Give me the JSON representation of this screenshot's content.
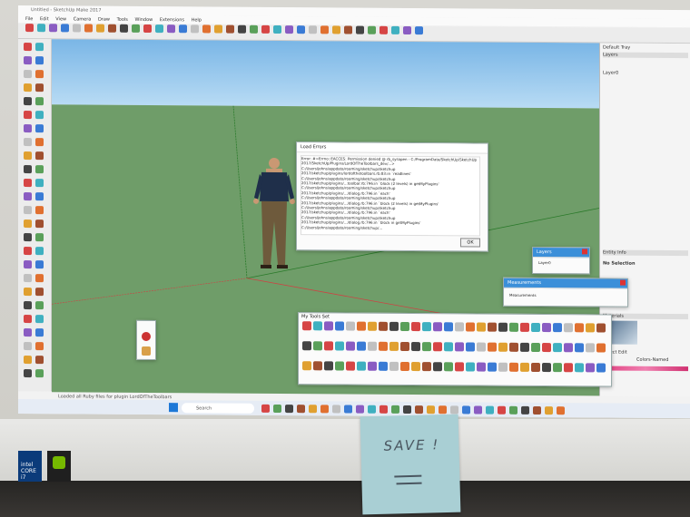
{
  "sketchup": {
    "title": "Untitled - SketchUp Make 2017",
    "menu": [
      "File",
      "Edit",
      "View",
      "Camera",
      "Draw",
      "Tools",
      "Window",
      "Extensions",
      "Help"
    ],
    "status": "Loaded all Ruby files for plugin LordOfTheToolbars",
    "search_placeholder": "Search"
  },
  "load_errors": {
    "title": "Load Errors",
    "text": "Error: #<Errno::EACCES: Permission denied @ rb_sysopen - C:/ProgramData/SketchUp/SketchUp\n2017/SketchUp/Plugins/LordOfTheToolbars_dev/...>\nC:/Users/johns/appdata/roaming/sketchup/sketchup\n2017/sketchup/plugins/lordofthetoolbars.rb:83:in `readlines'\nC:/Users/johns/appdata/roaming/sketchup/sketchup\n2017/sketchup/plugins/...toolbar.rb:796:in `block (2 levels) in getMyPlugins'\nC:/Users/johns/appdata/roaming/sketchup/sketchup\n2017/sketchup/plugins/.../dialog.rb:796:in `each'\nC:/Users/johns/appdata/roaming/sketchup/sketchup\n2017/sketchup/plugins/.../dialog.rb:796:in `block (2 levels) in getMyPlugins'\nC:/Users/johns/appdata/roaming/sketchup/sketchup\n2017/sketchup/plugins/.../dialog.rb:796:in `each'\nC:/Users/johns/appdata/roaming/sketchup/sketchup\n2017/sketchup/plugins/.../dialog.rb:796:in `block in getMyPlugins'\nC:/Users/johns/appdata/roaming/sketchup/...",
    "ok": "OK"
  },
  "layers_panel": {
    "title": "Layers",
    "item": "Layer0"
  },
  "measurements_panel": {
    "title": "Measurements",
    "label": "Measurements"
  },
  "my_tools": {
    "title": "My Tools Set"
  },
  "right_panel": {
    "tray": "Default Tray",
    "layers": "Layers",
    "entity_info": "Entity Info",
    "no_selection": "No Selection",
    "materials": "Materials",
    "select_tab": "Select",
    "edit_tab": "Edit",
    "colors_named": "Colors-Named",
    "layer0": "Layer0"
  },
  "note": {
    "text": "SAVE !"
  },
  "stickers": {
    "intel": "intel CORE i7"
  },
  "colors": {
    "sky": "#8ec4ec",
    "ground": "#6f9d69",
    "note": "#a9cfd4"
  }
}
